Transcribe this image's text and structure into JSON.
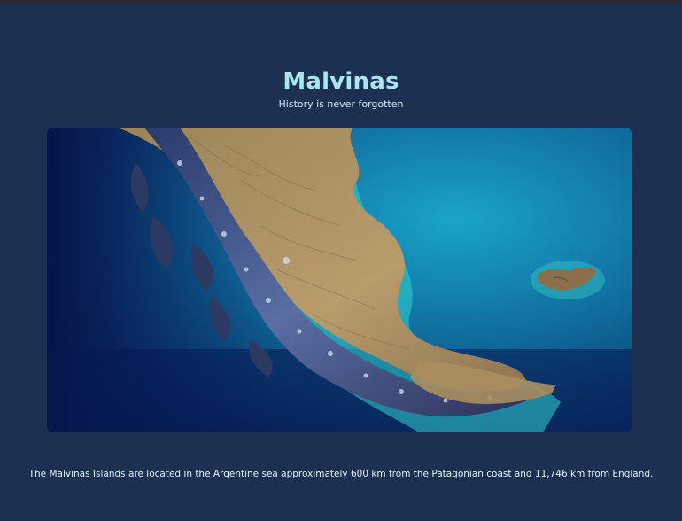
{
  "header": {
    "title": "Malvinas",
    "subtitle": "History is never forgotten"
  },
  "map_image": {
    "icon": "satellite-map-patagonia-malvinas",
    "colors": {
      "deep_ocean": "#0b1f55",
      "shallow_ocean": "#17a5c4",
      "coast_turquoise": "#3fe0d0",
      "land": "#b49a6a",
      "mountains": "#3b4a78",
      "snow": "#cfe1f5"
    }
  },
  "caption": {
    "text": "The Malvinas Islands are located in the Argentine sea approximately 600 km from the Patagonian coast and 11,746 km from England."
  },
  "theme": {
    "background": "#1c3052",
    "title_color": "#a9e6f2"
  }
}
